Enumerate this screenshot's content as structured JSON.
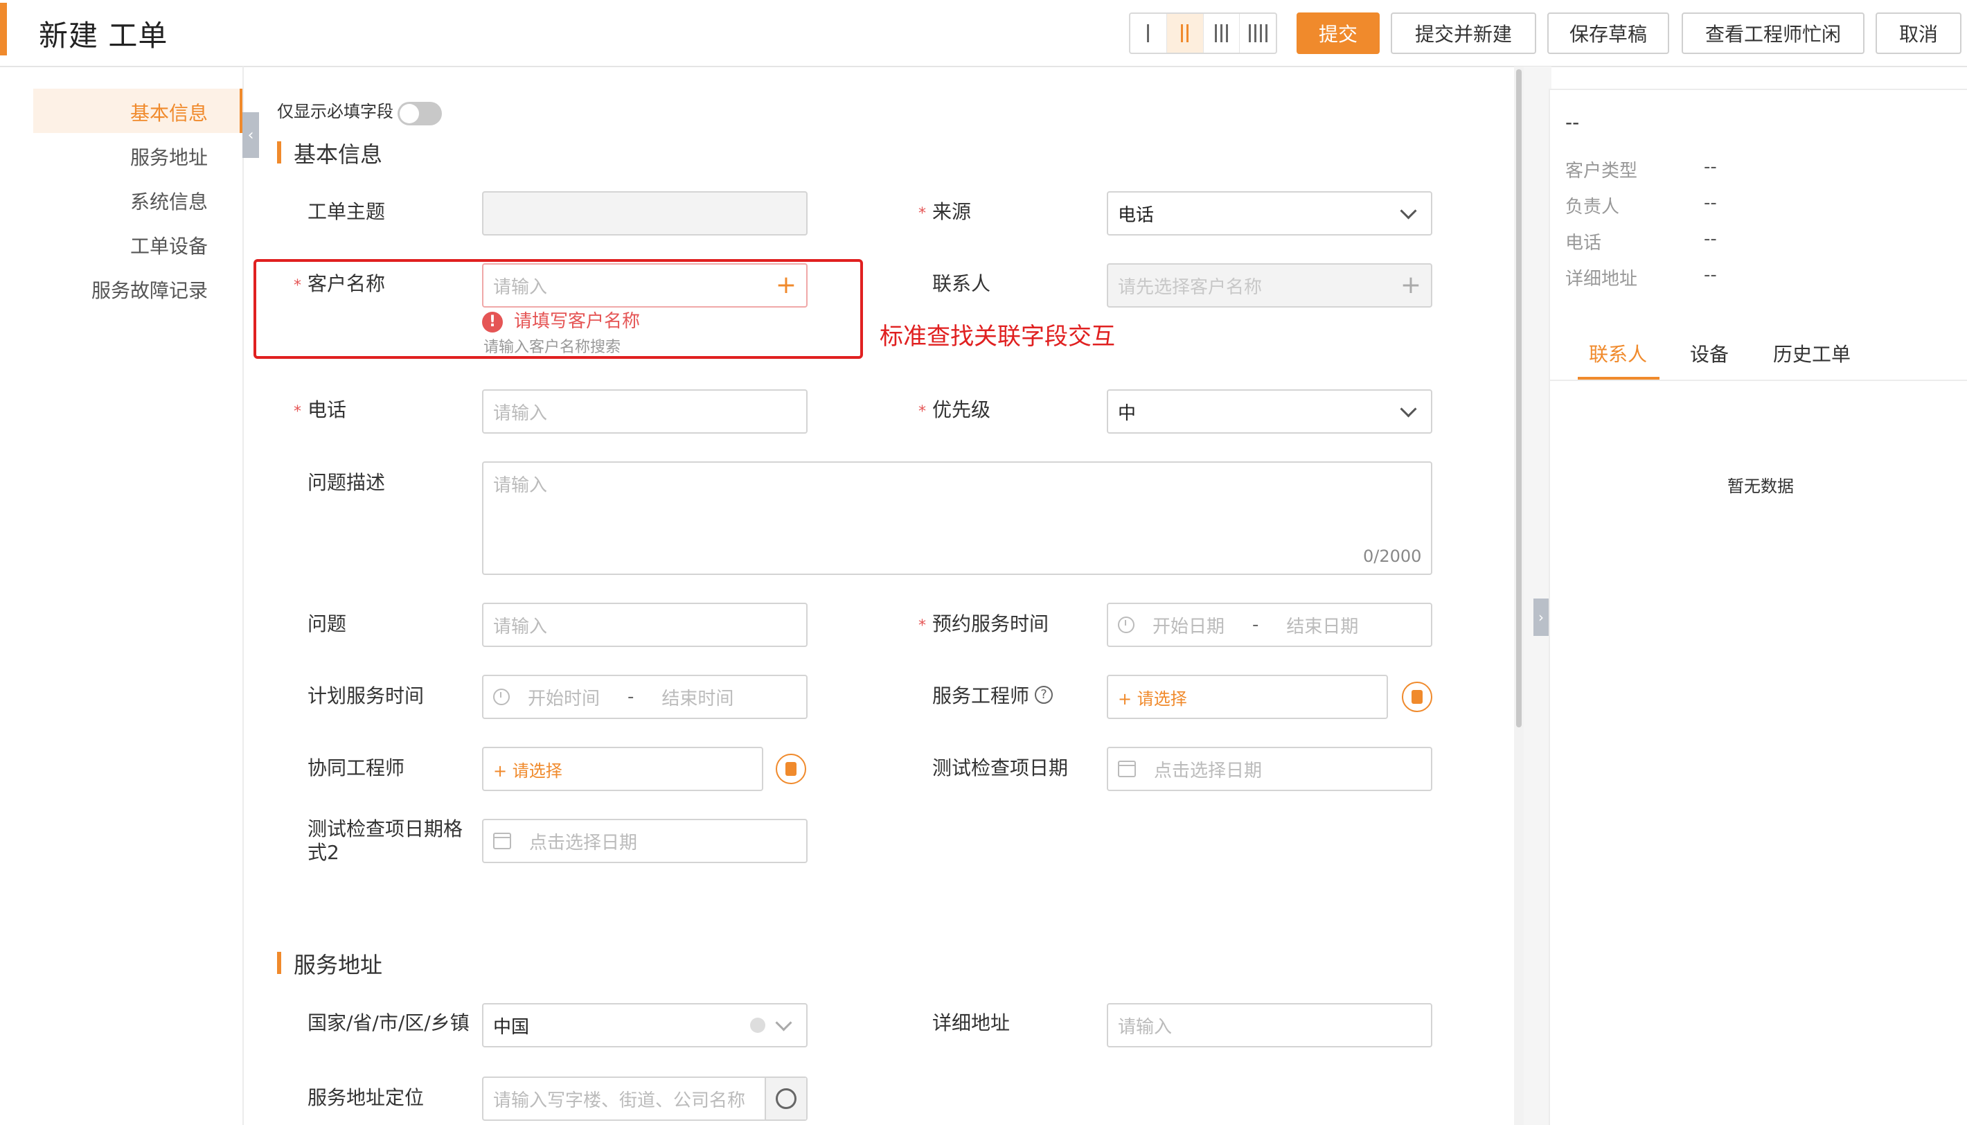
{
  "header": {
    "title": "新建 工单",
    "buttons": {
      "submit": "提交",
      "submit_new": "提交并新建",
      "save_draft": "保存草稿",
      "engineer_busy": "查看工程师忙闲",
      "cancel": "取消"
    }
  },
  "nav": {
    "items": [
      "基本信息",
      "服务地址",
      "系统信息",
      "工单设备",
      "服务故障记录"
    ]
  },
  "form": {
    "toggle_label": "仅显示必填字段",
    "sections": {
      "basic": "基本信息",
      "address": "服务地址"
    },
    "fields": {
      "subject": {
        "label": "工单主题"
      },
      "source": {
        "label": "来源",
        "value": "电话"
      },
      "customer": {
        "label": "客户名称",
        "placeholder": "请输入",
        "error": "请填写客户名称",
        "hint": "请输入客户名称搜索"
      },
      "contact": {
        "label": "联系人",
        "placeholder": "请先选择客户名称"
      },
      "phone": {
        "label": "电话",
        "placeholder": "请输入"
      },
      "priority": {
        "label": "优先级",
        "value": "中"
      },
      "description": {
        "label": "问题描述",
        "placeholder": "请输入",
        "counter": "0/2000"
      },
      "issue": {
        "label": "问题",
        "placeholder": "请输入"
      },
      "appointment": {
        "label": "预约服务时间",
        "start": "开始日期",
        "sep": "-",
        "end": "结束日期"
      },
      "planned": {
        "label": "计划服务时间",
        "start": "开始时间",
        "sep": "-",
        "end": "结束时间"
      },
      "engineer": {
        "label": "服务工程师",
        "placeholder": "+ 请选择"
      },
      "co_engineer": {
        "label": "协同工程师",
        "placeholder": "+ 请选择"
      },
      "test_date": {
        "label": "测试检查项日期",
        "placeholder": "点击选择日期"
      },
      "test_date2": {
        "label_line1": "测试检查项日期格",
        "label_line2": "式2",
        "placeholder": "点击选择日期"
      },
      "region": {
        "label": "国家/省/市/区/乡镇",
        "value": "中国"
      },
      "address_detail": {
        "label": "详细地址",
        "placeholder": "请输入"
      },
      "address_locate": {
        "label": "服务地址定位",
        "placeholder": "请输入写字楼、街道、公司名称"
      }
    }
  },
  "annotation": "标准查找关联字段交互",
  "right_panel": {
    "title": "--",
    "rows": [
      {
        "label": "客户类型",
        "value": "--"
      },
      {
        "label": "负责人",
        "value": "--"
      },
      {
        "label": "电话",
        "value": "--"
      },
      {
        "label": "详细地址",
        "value": "--"
      }
    ],
    "tabs": [
      "联系人",
      "设备",
      "历史工单"
    ],
    "empty": "暂无数据"
  },
  "colors": {
    "accent": "#f08a2c",
    "error": "#e55555",
    "annotation": "#e02020"
  }
}
